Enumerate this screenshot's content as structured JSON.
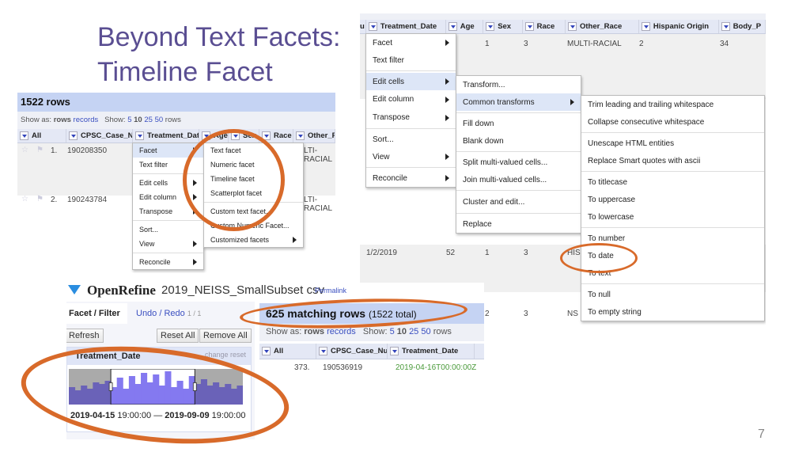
{
  "slide": {
    "title_line1": "Beyond Text Facets:",
    "title_line2": "Timeline Facet",
    "page_number": "7"
  },
  "shot_a": {
    "row_count": "1522 rows",
    "show_as_label": "Show as:",
    "rows": "rows",
    "records": "records",
    "show_label": "Show:",
    "page_sizes": [
      "5",
      "10",
      "25",
      "50"
    ],
    "rows_suffix": "rows",
    "columns": [
      "All",
      "CPSC_Case_Nu",
      "Treatment_Date",
      "Age",
      "Sex",
      "Race",
      "Other_Ra"
    ],
    "rows_data": [
      {
        "index": "1.",
        "case": "190208350",
        "other": "LTI-RACIAL"
      },
      {
        "index": "2.",
        "case": "190243784",
        "other": "LTI-RACIAL"
      }
    ],
    "menu": [
      "Facet",
      "Text filter",
      "Edit cells",
      "Edit column",
      "Transpose",
      "Sort...",
      "View",
      "Reconcile"
    ],
    "facet_submenu": [
      "Text facet",
      "Numeric facet",
      "Timeline facet",
      "Scatterplot facet",
      "Custom text facet...",
      "Custom Numeric Facet...",
      "Customized facets"
    ]
  },
  "shot_b": {
    "columns": [
      "u",
      "Treatment_Date",
      "Age",
      "Sex",
      "Race",
      "Other_Race",
      "Hispanic Origin",
      "Body_P"
    ],
    "row1": {
      "sex": "1",
      "race": "3",
      "other_race": "MULTI-RACIAL",
      "hispanic": "2",
      "body": "34"
    },
    "row2": {
      "date": "1/2/2019",
      "age": "52",
      "sex": "1",
      "race": "3",
      "other_race": "HIS"
    },
    "row3": {
      "sex": "2",
      "race": "3",
      "other_race": "NS"
    },
    "menu": [
      "Facet",
      "Text filter",
      "Edit cells",
      "Edit column",
      "Transpose",
      "Sort...",
      "View",
      "Reconcile"
    ],
    "edit_cells_submenu": [
      "Transform...",
      "Common transforms",
      "Fill down",
      "Blank down",
      "Split multi-valued cells...",
      "Join multi-valued cells...",
      "Cluster and edit...",
      "Replace"
    ],
    "common_transforms": [
      "Trim leading and trailing whitespace",
      "Collapse consecutive whitespace",
      "Unescape HTML entities",
      "Replace Smart quotes with ascii",
      "To titlecase",
      "To uppercase",
      "To lowercase",
      "To number",
      "To date",
      "To text",
      "To null",
      "To empty string"
    ]
  },
  "shot_c": {
    "app_name": "OpenRefine",
    "project": "2019_NEISS_SmallSubset csv",
    "permalink": "Permalink",
    "tab_facet": "Facet / Filter",
    "tab_undo": "Undo / Redo",
    "undo_count": "1 / 1",
    "refresh": "Refresh",
    "reset_all": "Reset All",
    "remove_all": "Remove All",
    "facet_title": "Treatment_Date",
    "facet_links": "change  reset",
    "histogram": [
      22,
      18,
      24,
      20,
      28,
      26,
      30,
      22,
      34,
      20,
      36,
      26,
      40,
      28,
      38,
      24,
      42,
      22,
      30,
      20,
      36,
      26,
      32,
      24,
      28,
      22,
      26,
      20,
      24
    ],
    "histogram_selection": {
      "from_bin": 7,
      "to_bin": 20
    },
    "range_from_date": "2019-04-15",
    "range_from_time": "19:00:00",
    "range_sep": "—",
    "range_to_date": "2019-09-09",
    "range_to_time": "19:00:00",
    "matching": "625 matching rows",
    "total": "(1522 total)",
    "show_as_label": "Show as:",
    "rows": "rows",
    "records": "records",
    "show_label": "Show:",
    "page_sizes": [
      "5",
      "10",
      "25",
      "50"
    ],
    "rows_suffix": "rows",
    "columns": [
      "All",
      "CPSC_Case_Nu",
      "Treatment_Date"
    ],
    "row": {
      "index": "373.",
      "case": "190536919",
      "date": "2019-04-16T00:00:00Z"
    }
  },
  "colors": {
    "title": "#5a4e92",
    "highlight_ring": "#d86a2a",
    "header_band": "#c5d3f3",
    "histogram_bar": "#6a62b8",
    "histogram_selected": "#8479f0",
    "date_green": "#4a9a3a"
  }
}
